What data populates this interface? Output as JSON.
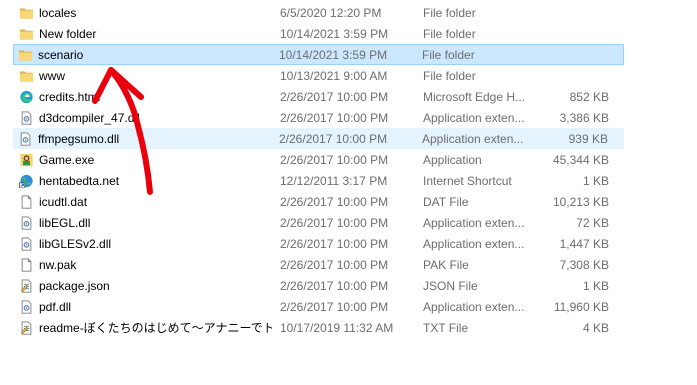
{
  "files": [
    {
      "name": "locales",
      "date": "6/5/2020 12:20 PM",
      "type": "File folder",
      "size": "",
      "icon": "folder-icon",
      "state": ""
    },
    {
      "name": "New folder",
      "date": "10/14/2021 3:59 PM",
      "type": "File folder",
      "size": "",
      "icon": "folder-icon",
      "state": ""
    },
    {
      "name": "scenario",
      "date": "10/14/2021 3:59 PM",
      "type": "File folder",
      "size": "",
      "icon": "folder-icon",
      "state": "selected"
    },
    {
      "name": "www",
      "date": "10/13/2021 9:00 AM",
      "type": "File folder",
      "size": "",
      "icon": "folder-icon",
      "state": ""
    },
    {
      "name": "credits.html",
      "date": "2/26/2017 10:00 PM",
      "type": "Microsoft Edge H...",
      "size": "852 KB",
      "icon": "edge-icon",
      "state": ""
    },
    {
      "name": "d3dcompiler_47.dll",
      "date": "2/26/2017 10:00 PM",
      "type": "Application exten...",
      "size": "3,386 KB",
      "icon": "dll-icon",
      "state": ""
    },
    {
      "name": "ffmpegsumo.dll",
      "date": "2/26/2017 10:00 PM",
      "type": "Application exten...",
      "size": "939 KB",
      "icon": "dll-icon",
      "state": "hover"
    },
    {
      "name": "Game.exe",
      "date": "2/26/2017 10:00 PM",
      "type": "Application",
      "size": "45,344 KB",
      "icon": "game-exe-icon",
      "state": ""
    },
    {
      "name": "hentabedta.net",
      "date": "12/12/2011 3:17 PM",
      "type": "Internet Shortcut",
      "size": "1 KB",
      "icon": "internet-shortcut-icon",
      "state": ""
    },
    {
      "name": "icudtl.dat",
      "date": "2/26/2017 10:00 PM",
      "type": "DAT File",
      "size": "10,213 KB",
      "icon": "blank-file-icon",
      "state": ""
    },
    {
      "name": "libEGL.dll",
      "date": "2/26/2017 10:00 PM",
      "type": "Application exten...",
      "size": "72 KB",
      "icon": "dll-icon",
      "state": ""
    },
    {
      "name": "libGLESv2.dll",
      "date": "2/26/2017 10:00 PM",
      "type": "Application exten...",
      "size": "1,447 KB",
      "icon": "dll-icon",
      "state": ""
    },
    {
      "name": "nw.pak",
      "date": "2/26/2017 10:00 PM",
      "type": "PAK File",
      "size": "7,308 KB",
      "icon": "blank-file-icon",
      "state": ""
    },
    {
      "name": "package.json",
      "date": "2/26/2017 10:00 PM",
      "type": "JSON File",
      "size": "1 KB",
      "icon": "notepad-file-icon",
      "state": ""
    },
    {
      "name": "pdf.dll",
      "date": "2/26/2017 10:00 PM",
      "type": "Application exten...",
      "size": "11,960 KB",
      "icon": "dll-icon",
      "state": ""
    },
    {
      "name": "readme-ぼくたちのはじめて〜アナニーでト...",
      "date": "10/17/2019 11:32 AM",
      "type": "TXT File",
      "size": "4 KB",
      "icon": "notepad-file-icon",
      "state": ""
    }
  ],
  "colors": {
    "selection_bg": "#cce8ff",
    "selection_border": "#99d1ff",
    "hover_bg": "#e5f3ff",
    "secondary_text": "#6d6d6d",
    "folder": "#f8d775",
    "annotation": "#e8000d"
  },
  "annotation": {
    "icon": "red-arrow-annotation",
    "points_to": "scenario"
  }
}
